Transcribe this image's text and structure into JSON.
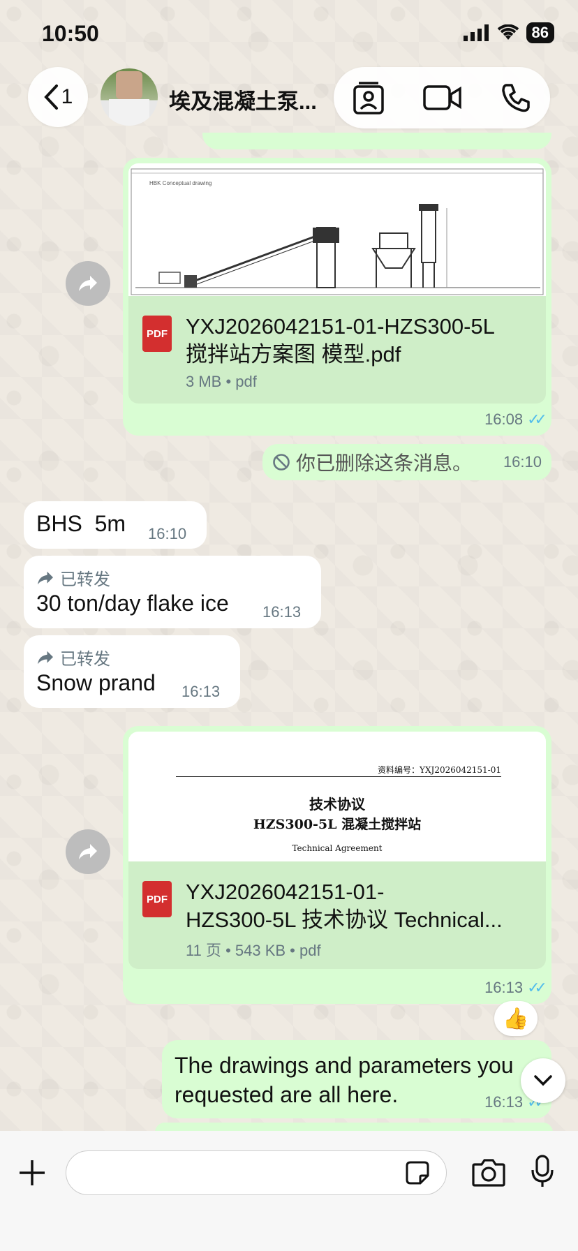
{
  "status_bar": {
    "time": "10:50",
    "battery": "86"
  },
  "header": {
    "back_count": "1",
    "contact_name": "埃及混凝土泵..."
  },
  "messages": {
    "file1": {
      "filename_line1": "YXJ2026042151-01-HZS300-5L",
      "filename_line2": "搅拌站方案图 模型.pdf",
      "meta": "3 MB • pdf",
      "time": "16:08",
      "thumb_caption": "HBK Conceptual drawing"
    },
    "deleted": {
      "text": "你已删除这条消息。",
      "time": "16:10"
    },
    "bhs": {
      "text": "BHS  5m",
      "time": "16:10"
    },
    "fwd1": {
      "label": "已转发",
      "text": "30 ton/day flake ice",
      "time": "16:13"
    },
    "fwd2": {
      "label": "已转发",
      "text": "Snow prand",
      "time": "16:13"
    },
    "file2": {
      "thumb_code": "资料编号：YXJ2026042151-01",
      "thumb_title1": "技术协议",
      "thumb_title2": "HZS300-5L 混凝土搅拌站",
      "thumb_title3": "Technical Agreement",
      "filename_line1": "YXJ2026042151-01-",
      "filename_line2": "HZS300-5L 技术协议 Technical...",
      "meta": "11 页 • 543 KB • pdf",
      "time": "16:13"
    },
    "reaction": "👍",
    "final": {
      "line1": "The drawings and parameters you",
      "line2": "requested are all here.",
      "time": "16:13"
    }
  }
}
